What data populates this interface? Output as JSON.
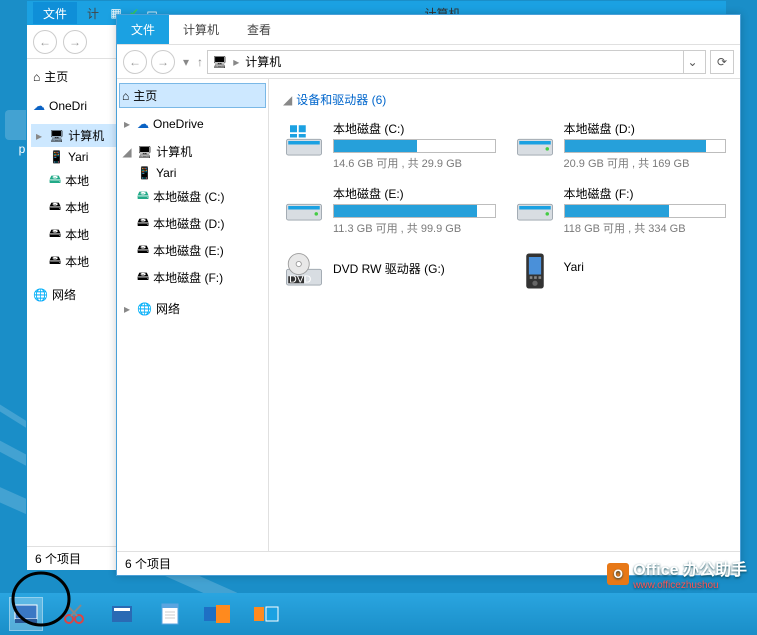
{
  "back_window": {
    "file_tab": "文件",
    "tab2_partial": "计",
    "title": "计算机",
    "tree": {
      "home": "主页",
      "onedrive_partial": "OneDri",
      "computer_partial": "计算机",
      "yari": "Yari",
      "disk1_partial": "本地",
      "disk2_partial": "本地",
      "disk3_partial": "本地",
      "disk4_partial": "本地",
      "network": "网络"
    },
    "status": "6 个项目"
  },
  "front_window": {
    "ribbon": {
      "file": "文件",
      "computer": "计算机",
      "view": "查看"
    },
    "address": "计算机",
    "tree": {
      "home": "主页",
      "onedrive": "OneDrive",
      "computer": "计算机",
      "yari": "Yari",
      "disk_c": "本地磁盘 (C:)",
      "disk_d": "本地磁盘 (D:)",
      "disk_e": "本地磁盘 (E:)",
      "disk_f": "本地磁盘 (F:)",
      "network": "网络"
    },
    "group_header": "设备和驱动器 (6)",
    "drives": [
      {
        "name": "本地磁盘 (C:)",
        "free": "14.6 GB 可用 , 共 29.9 GB",
        "used_pct": 52
      },
      {
        "name": "本地磁盘 (D:)",
        "free": "20.9 GB 可用 , 共 169 GB",
        "used_pct": 88
      },
      {
        "name": "本地磁盘 (E:)",
        "free": "11.3 GB 可用 , 共 99.9 GB",
        "used_pct": 89
      },
      {
        "name": "本地磁盘 (F:)",
        "free": "118 GB 可用 , 共 334 GB",
        "used_pct": 65
      }
    ],
    "dvd": {
      "name": "DVD RW 驱动器 (G:)"
    },
    "phone": {
      "name": "Yari"
    },
    "status": "6 个项目"
  },
  "watermark": {
    "text": "Office 办公助手",
    "sub": "www.officezhushou"
  }
}
